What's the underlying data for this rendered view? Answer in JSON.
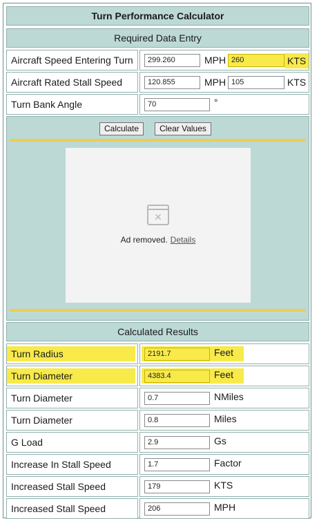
{
  "title": "Turn Performance Calculator",
  "entry": {
    "section_label": "Required Data Entry",
    "speed": {
      "label": "Aircraft Speed Entering Turn",
      "mph_value": "299.260",
      "mph_unit": "MPH",
      "kts_value": "260",
      "kts_unit": "KTS"
    },
    "stall": {
      "label": "Aircraft Rated Stall Speed",
      "mph_value": "120.855",
      "mph_unit": "MPH",
      "kts_value": "105",
      "kts_unit": "KTS"
    },
    "bank": {
      "label": "Turn Bank Angle",
      "value": "70",
      "unit": "°"
    }
  },
  "buttons": {
    "calculate": "Calculate",
    "clear": "Clear Values"
  },
  "ad": {
    "text": "Ad removed.",
    "details": "Details"
  },
  "results": {
    "section_label": "Calculated Results",
    "rows": [
      {
        "label": "Turn Radius",
        "value": "2191.7",
        "unit": "Feet",
        "highlighted": true
      },
      {
        "label": "Turn Diameter",
        "value": "4383.4",
        "unit": "Feet",
        "highlighted": true
      },
      {
        "label": "Turn Diameter",
        "value": "0.7",
        "unit": "NMiles"
      },
      {
        "label": "Turn Diameter",
        "value": "0.8",
        "unit": "Miles"
      },
      {
        "label": "G Load",
        "value": "2.9",
        "unit": "Gs"
      },
      {
        "label": "Increase In Stall Speed",
        "value": "1.7",
        "unit": "Factor"
      },
      {
        "label": "Increased Stall Speed",
        "value": "179",
        "unit": "KTS"
      },
      {
        "label": "Increased Stall Speed",
        "value": "206",
        "unit": "MPH"
      }
    ]
  },
  "colors": {
    "panel": "#bcd9d6",
    "highlight": "#f7ea4a",
    "divider": "#f2cc4a"
  }
}
